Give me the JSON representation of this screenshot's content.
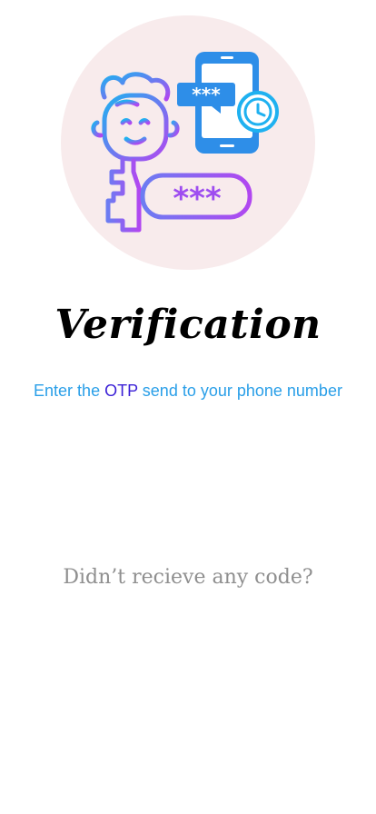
{
  "screen": {
    "title": "Verification",
    "subtitle": {
      "prefix": "Enter the",
      "highlight": "OTP",
      "suffix": "send to your phone number"
    },
    "resend_prompt": "Didn’t recieve any code?"
  },
  "illustration": {
    "name": "otp-verification-illustration",
    "phone_bubble_text": "***",
    "key_password_text": "***",
    "colors": {
      "circle_bg": "#f8ebec",
      "gradient_start": "#1fb1f0",
      "gradient_end": "#b147f0"
    }
  },
  "colors": {
    "subtitle": "#2a9fe8",
    "otp_highlight": "#3a1fd6",
    "resend_text": "#8f8f8f"
  }
}
